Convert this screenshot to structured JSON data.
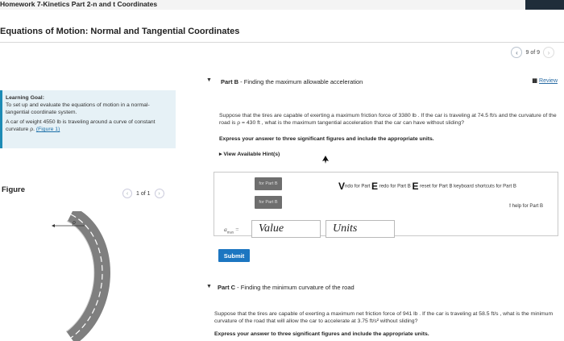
{
  "top_bar": {
    "title": "Homework 7-Kinetics Part 2-n and t Coordinates"
  },
  "page": {
    "title": "Equations of Motion: Normal and Tangential Coordinates"
  },
  "pager": {
    "text": "9 of 9"
  },
  "left_panel": {
    "goal_heading": "Learning Goal:",
    "goal_text": "To set up and evaluate the equations of motion in a normal-tangential coordinate system.",
    "intro_text": "A car of weight 4550  lb is traveling around a curve of constant curvature ρ.",
    "figure_link": "(Figure 1)"
  },
  "figure": {
    "label": "Figure",
    "pager": "1 of 1",
    "rho_label": "ρ"
  },
  "part_b": {
    "title_prefix": "Part B",
    "title_text": " - Finding the maximum allowable acceleration",
    "review_label": "Review",
    "problem_text": "Suppose that the tires are capable of exerting a maximum friction force of 3380  lb . If the car is traveling at 74.5  ft/s and the curvature of the road is ρ = 430  ft , what is the maximum tangential acceleration that the car can have without sliding?",
    "instruction": "Express your answer to three significant figures and include the appropriate units.",
    "hints_label": "View Available Hint(s)",
    "toolbar": {
      "template_btn": "for Part B",
      "template_btn2": "for Part B",
      "undo_text": "ndo for Part",
      "redo_text": "redo for Part B",
      "reset_text": "reset for Part B",
      "keyboard_text": "keyboard shortcuts for Part B",
      "help_text": "help for Part B"
    },
    "answer_label": "a",
    "answer_subscript": "max",
    "answer_equals": " =",
    "value_placeholder": "Value",
    "units_placeholder": "Units",
    "submit_label": "Submit"
  },
  "part_c": {
    "title_prefix": "Part C",
    "title_text": " - Finding the minimum curvature of the road",
    "problem_text": "Suppose that the tires are capable of exerting a maximum net friction force of 941  lb . If the car is traveling at 58.5  ft/s , what is the minimum curvature of the road that will allow the car to accelerate at 3.75  ft/s² without sliding?",
    "instruction": "Express your answer to three significant figures and include the appropriate units."
  },
  "colors": {
    "accent": "#1c76c1",
    "panel_bg": "#e6f1f6",
    "panel_border": "#1d8bb5",
    "road": "#8a8a8a"
  }
}
